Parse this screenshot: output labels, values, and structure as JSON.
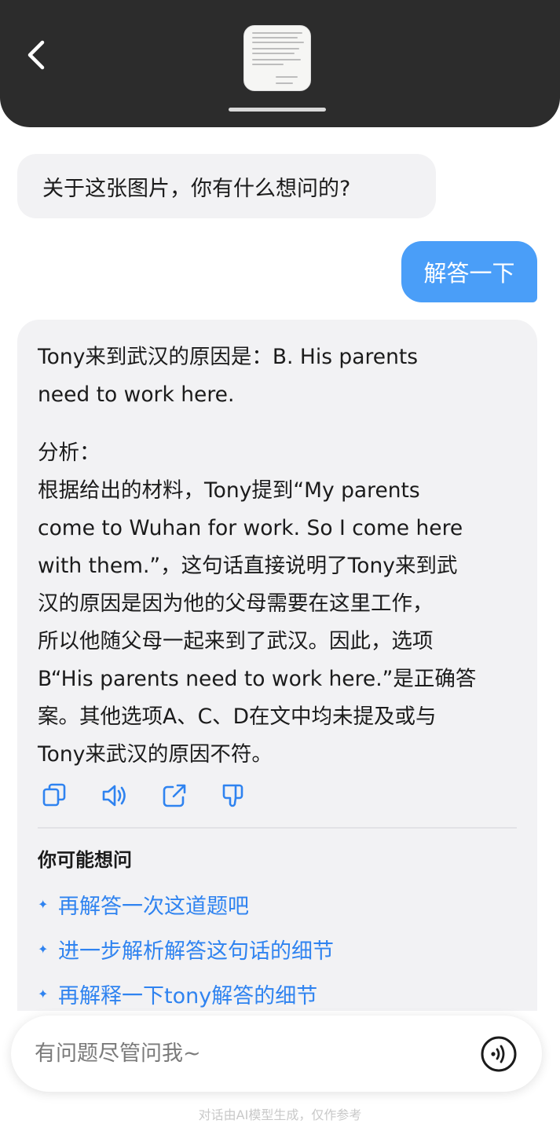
{
  "header": {
    "back_icon": "chevron-left-icon",
    "thumbnail_icon": "document-thumbnail"
  },
  "chat": {
    "bot_greeting": "关于这张图片，你有什么想问的?",
    "user_message": "解答一下",
    "answer": {
      "line1": "Tony来到武汉的原因是：B. His parents",
      "line2": "need to work here.",
      "analysis_label": "分析：",
      "lines": [
        "根据给出的材料，Tony提到“My parents",
        "come to Wuhan for work. So I come here",
        "with them.”，这句话直接说明了Tony来到武",
        "汉的原因是因为他的父母需要在这里工作，",
        "所以他随父母一起来到了武汉。因此，选项",
        "B“His parents need to work here.”是正确答",
        "案。其他选项A、C、D在文中均未提及或与",
        "Tony来武汉的原因不符。"
      ]
    },
    "actions": [
      "copy-icon",
      "speaker-icon",
      "share-icon",
      "thumbs-down-icon"
    ],
    "suggestions": {
      "title": "你可能想问",
      "items": [
        "再解答一次这道题吧",
        "进一步解析解答这句话的细节",
        "再解释一下tony解答的细节"
      ]
    }
  },
  "input": {
    "placeholder": "有问题尽管问我~",
    "voice_icon": "voice-icon"
  },
  "footer": {
    "note": "对话由AI模型生成，仅作参考"
  },
  "colors": {
    "header_bg": "#2c2c2c",
    "user_bubble": "#4a9ef8",
    "accent": "#2f83f0",
    "bubble_bg": "#f2f2f4"
  }
}
